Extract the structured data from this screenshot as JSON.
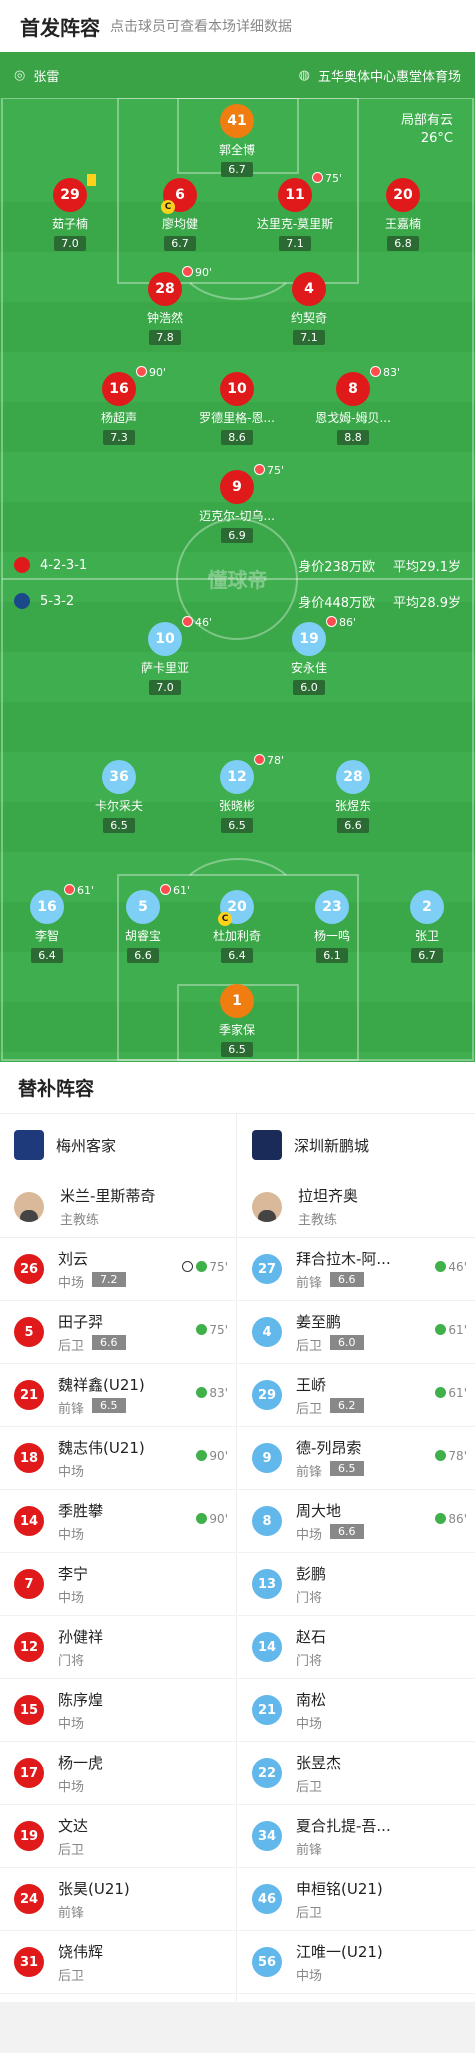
{
  "header": {
    "title": "首发阵容",
    "hint": "点击球员可查看本场详细数据"
  },
  "info": {
    "referee": "张雷",
    "stadium": "五华奥体中心惠堂体育场",
    "weather": "局部有云",
    "temp": "26°C"
  },
  "home": {
    "players": [
      {
        "num": "41",
        "name": "郭全博",
        "rating": "6.7",
        "color": "orange"
      },
      {
        "num": "29",
        "name": "茹子楠",
        "rating": "7.0",
        "color": "red"
      },
      {
        "num": "6",
        "name": "廖均健",
        "rating": "6.7",
        "color": "red"
      },
      {
        "num": "11",
        "name": "达里克-莫里斯",
        "rating": "7.1",
        "color": "red",
        "sub": "75'"
      },
      {
        "num": "20",
        "name": "王嘉楠",
        "rating": "6.8",
        "color": "red"
      },
      {
        "num": "28",
        "name": "钟浩然",
        "rating": "7.8",
        "color": "red",
        "sub": "90'"
      },
      {
        "num": "4",
        "name": "约契奇",
        "rating": "7.1",
        "color": "red"
      },
      {
        "num": "16",
        "name": "杨超声",
        "rating": "7.3",
        "color": "red",
        "sub": "90'"
      },
      {
        "num": "10",
        "name": "罗德里格-恩...",
        "rating": "8.6",
        "color": "red"
      },
      {
        "num": "8",
        "name": "恩戈姆-姆贝...",
        "rating": "8.8",
        "color": "red",
        "sub": "83'"
      },
      {
        "num": "9",
        "name": "迈克尔-切乌...",
        "rating": "6.9",
        "color": "red",
        "sub": "75'"
      }
    ],
    "formation": "4-2-3-1",
    "value": "身价238万欧",
    "age": "平均29.1岁"
  },
  "away": {
    "formation": "5-3-2",
    "value": "身价448万欧",
    "age": "平均28.9岁",
    "players": [
      {
        "num": "10",
        "name": "萨卡里亚",
        "rating": "7.0",
        "sub": "46'"
      },
      {
        "num": "19",
        "name": "安永佳",
        "rating": "6.0",
        "sub": "86'"
      },
      {
        "num": "36",
        "name": "卡尔采夫",
        "rating": "6.5"
      },
      {
        "num": "12",
        "name": "张晓彬",
        "rating": "6.5",
        "sub": "78'"
      },
      {
        "num": "28",
        "name": "张煜东",
        "rating": "6.6"
      },
      {
        "num": "16",
        "name": "李智",
        "rating": "6.4",
        "sub": "61'"
      },
      {
        "num": "5",
        "name": "胡睿宝",
        "rating": "6.6",
        "sub": "61'"
      },
      {
        "num": "20",
        "name": "杜加利奇",
        "rating": "6.4"
      },
      {
        "num": "23",
        "name": "杨一鸣",
        "rating": "6.1"
      },
      {
        "num": "2",
        "name": "张卫",
        "rating": "6.7"
      },
      {
        "num": "1",
        "name": "季家保",
        "rating": "6.5",
        "color": "orange"
      }
    ]
  },
  "watermark": "懂球帝",
  "subs": {
    "title": "替补阵容",
    "left": {
      "team": "梅州客家",
      "coach": {
        "name": "米兰-里斯蒂奇",
        "role": "主教练"
      },
      "players": [
        {
          "num": "26",
          "name": "刘云",
          "pos": "中场",
          "rating": "7.2",
          "evt": "75'",
          "goal": true
        },
        {
          "num": "5",
          "name": "田子羿",
          "pos": "后卫",
          "rating": "6.6",
          "evt": "75'"
        },
        {
          "num": "21",
          "name": "魏祥鑫(U21)",
          "pos": "前锋",
          "rating": "6.5",
          "evt": "83'"
        },
        {
          "num": "18",
          "name": "魏志伟(U21)",
          "pos": "中场",
          "evt": "90'"
        },
        {
          "num": "14",
          "name": "季胜攀",
          "pos": "中场",
          "evt": "90'"
        },
        {
          "num": "7",
          "name": "李宁",
          "pos": "中场"
        },
        {
          "num": "12",
          "name": "孙健祥",
          "pos": "门将"
        },
        {
          "num": "15",
          "name": "陈序煌",
          "pos": "中场"
        },
        {
          "num": "17",
          "name": "杨一虎",
          "pos": "中场"
        },
        {
          "num": "19",
          "name": "文达",
          "pos": "后卫"
        },
        {
          "num": "24",
          "name": "张昊(U21)",
          "pos": "前锋"
        },
        {
          "num": "31",
          "name": "饶伟辉",
          "pos": "后卫"
        }
      ]
    },
    "right": {
      "team": "深圳新鹏城",
      "coach": {
        "name": "拉坦齐奥",
        "role": "主教练"
      },
      "players": [
        {
          "num": "27",
          "name": "拜合拉木-阿...",
          "pos": "前锋",
          "rating": "6.6",
          "evt": "46'"
        },
        {
          "num": "4",
          "name": "姜至鹏",
          "pos": "后卫",
          "rating": "6.0",
          "evt": "61'"
        },
        {
          "num": "29",
          "name": "王峤",
          "pos": "后卫",
          "rating": "6.2",
          "evt": "61'"
        },
        {
          "num": "9",
          "name": "德-列昂索",
          "pos": "前锋",
          "rating": "6.5",
          "evt": "78'"
        },
        {
          "num": "8",
          "name": "周大地",
          "pos": "中场",
          "rating": "6.6",
          "evt": "86'"
        },
        {
          "num": "13",
          "name": "彭鹏",
          "pos": "门将"
        },
        {
          "num": "14",
          "name": "赵石",
          "pos": "门将"
        },
        {
          "num": "21",
          "name": "南松",
          "pos": "中场"
        },
        {
          "num": "22",
          "name": "张昱杰",
          "pos": "后卫"
        },
        {
          "num": "34",
          "name": "夏合扎提-吾...",
          "pos": "前锋"
        },
        {
          "num": "46",
          "name": "申桓铭(U21)",
          "pos": "后卫"
        },
        {
          "num": "56",
          "name": "江唯一(U21)",
          "pos": "中场"
        }
      ]
    }
  },
  "colors": {
    "pitch": "#3fae4e",
    "home": "#e01a1a",
    "away": "#7ecef5",
    "keeper": "#f07d0f"
  }
}
